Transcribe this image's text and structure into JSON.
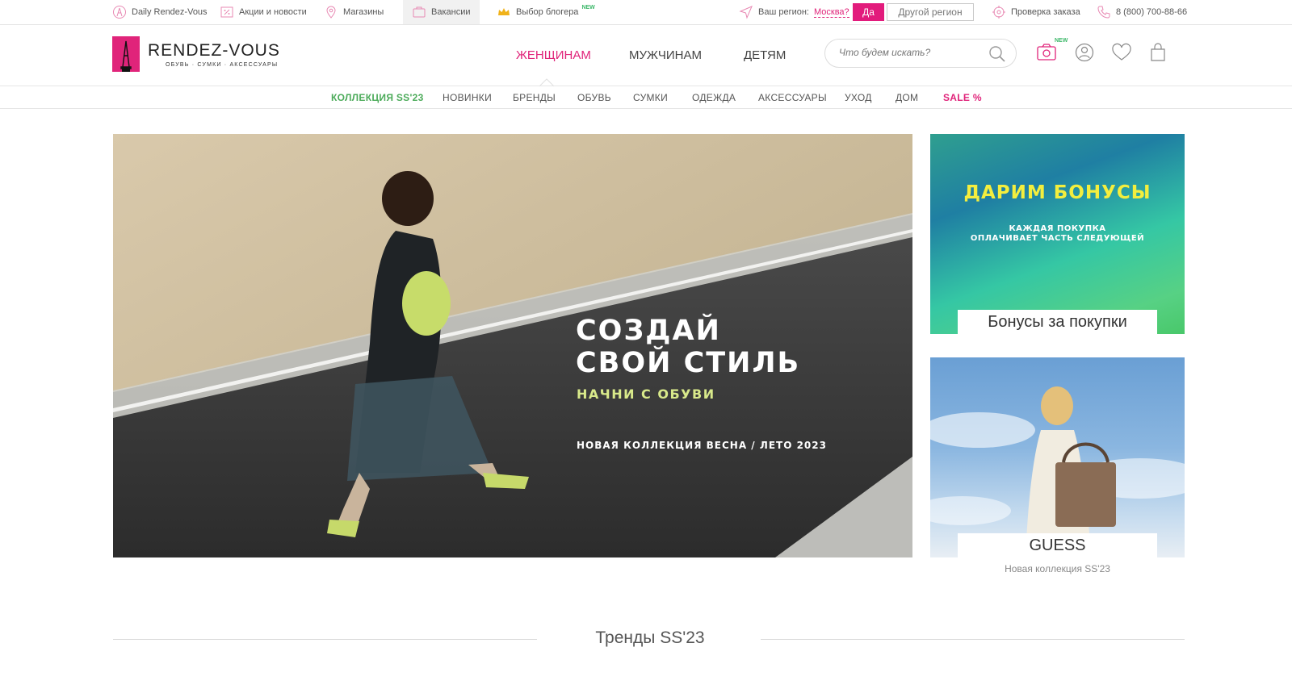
{
  "topbar": {
    "items": [
      {
        "label": "Daily Rendez-Vous",
        "icon": "daily-icon"
      },
      {
        "label": "Акции и новости",
        "icon": "percent-tag-icon"
      },
      {
        "label": "Магазины",
        "icon": "map-pin-icon"
      },
      {
        "label": "Вакансии",
        "icon": "briefcase-icon"
      },
      {
        "label": "Выбор блогера",
        "icon": "crown-icon",
        "badge": "NEW"
      }
    ],
    "region_prompt": "Ваш регион:",
    "region_value": "Москва?",
    "yes_label": "Да",
    "other_region_label": "Другой регион",
    "order_check": "Проверка заказа",
    "phone": "8 (800) 700-88-66"
  },
  "logo": {
    "name": "RENDEZ-VOUS",
    "tagline": "ОБУВЬ · СУМКИ · АКСЕССУАРЫ"
  },
  "gender_nav": {
    "women": "ЖЕНЩИНАМ",
    "men": "МУЖЧИНАМ",
    "kids": "ДЕТЯМ"
  },
  "search": {
    "placeholder": "Что будем искать?"
  },
  "header_icons": {
    "photo_search_badge": "NEW"
  },
  "categories": [
    "КОЛЛЕКЦИЯ SS'23",
    "НОВИНКИ",
    "БРЕНДЫ",
    "ОБУВЬ",
    "СУМКИ",
    "ОДЕЖДА",
    "АКСЕССУАРЫ",
    "УХОД",
    "ДОМ",
    "SALE %"
  ],
  "hero": {
    "title_line1": "СОЗДАЙ",
    "title_line2": "СВОЙ СТИЛЬ",
    "subtitle": "НАЧНИ С ОБУВИ",
    "note": "НОВАЯ КОЛЛЕКЦИЯ  ВЕСНА / ЛЕТО 2023"
  },
  "promo_bonus": {
    "title": "ДАРИМ БОНУСЫ",
    "sub_line1": "КАЖДАЯ ПОКУПКА",
    "sub_line2": "ОПЛАЧИВАЕТ ЧАСТЬ СЛЕДУЮЩЕЙ",
    "label": "Бонусы за покупки"
  },
  "promo_brand": {
    "label": "GUESS",
    "caption": "Новая коллекция SS'23"
  },
  "trends": {
    "title": "Тренды SS'23"
  },
  "colors": {
    "accent": "#e0247a",
    "green": "#4cab5a",
    "new_badge": "#3db86a"
  }
}
